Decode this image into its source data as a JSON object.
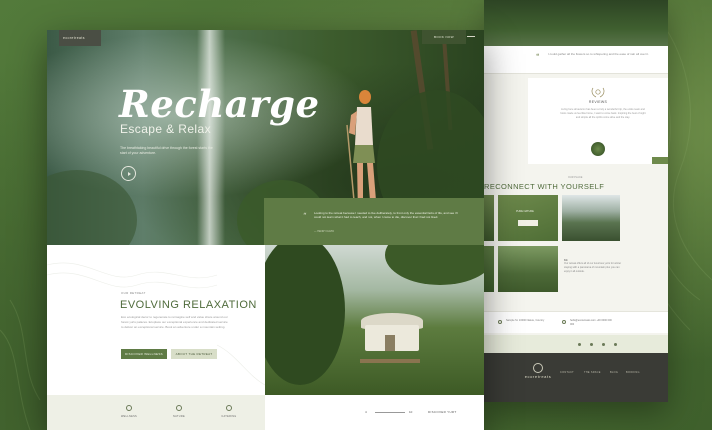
{
  "colors": {
    "background": "#4e7137",
    "brand_green": "#5f7b45",
    "heading_green": "#4f6b3b",
    "footer_dark": "#3a3b36",
    "light_sage": "#eef0e6"
  },
  "icons": {
    "hero_play": "play-icon",
    "quote": "quote-icon",
    "award": "laurel-icon",
    "feature_1": "lotus-icon",
    "feature_2": "leaf-icon",
    "feature_3": "dining-icon"
  },
  "main": {
    "header": {
      "logo": "ecoretreats",
      "book_button": "BOOK NOW"
    },
    "hero": {
      "title": "Recharge",
      "subtitle": "Escape & Relax",
      "description": "The breathtaking beautiful drive through the forest starts the start of your adventure."
    },
    "quote": {
      "mark": "“",
      "text": "Looking to the retreat because I needed to live deliberately, to front only the essential facts of life, and see if I could not learn what it had to teach, and not, when I came to die, discover that I had not lived.",
      "cite": "— HENRY DAVID"
    },
    "relax": {
      "eyebrow": "OUR RETREAT",
      "title": "EVOLVING RELAXATION",
      "body": "Eco ecological decor to regenerate to reimagine self and value share around our forest yurts palaces. Ecoplace our exceptional experience and dedicated service to deliver an exceptional service. Book an adventure under a mountain setting.",
      "primary_button": "DISCOVER WELLNESS",
      "secondary_button": "ABOUT THE RETREAT"
    },
    "features": [
      {
        "label": "WELLNESS"
      },
      {
        "label": "NATURE"
      },
      {
        "label": "CATERING"
      }
    ],
    "pager": {
      "current": "4",
      "total": "10",
      "label": "DISCOVER YURT"
    }
  },
  "back": {
    "quote_text": "I could gather all the flowers so to whispering and the ease of rain all over it.",
    "award": {
      "title": "REVIEWS",
      "body": "Living here all autumn has been a truly a wonderful trip, the entire team and hosts made us feel like home, I want to come back. Inspiring the best of sight and simple all the spirits come alive and the stay.",
      "reviewer": "JOHN DOE"
    },
    "connect": {
      "eyebrow": "OUR PLACE",
      "title": "RECONNECT WITH YOURSELF",
      "tile_label": "PURE NATURE",
      "tile_button": "BOOK"
    },
    "side_text": {
      "heading": "Kit",
      "body": "Our retreat offers all of our luxurious yurts for winter staying with a panorama of mountain plus you can enjoy it all outside."
    },
    "info": [
      {
        "text": "Sample St. 10000 Nature, Country"
      },
      {
        "text": "hello@ecoretreats.com +00 0000 000 000"
      }
    ],
    "footer": {
      "logo": "ecoretreats",
      "nav": [
        "CONTACT",
        "THE SPACE",
        "BLOG",
        "BOOKING"
      ]
    }
  }
}
